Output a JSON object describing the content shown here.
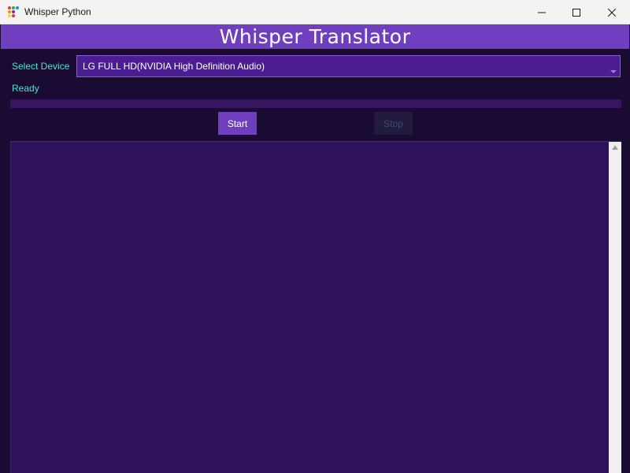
{
  "window": {
    "title": "Whisper Python",
    "controls": {
      "minimize_icon": "minimize-icon",
      "maximize_icon": "maximize-icon",
      "close_icon": "close-icon"
    }
  },
  "header": {
    "title": "Whisper Translator"
  },
  "device": {
    "label": "Select Device",
    "selected": "LG FULL HD(NVIDIA High Definition Audio)"
  },
  "status": {
    "text": "Ready"
  },
  "progress": {
    "value": 0
  },
  "buttons": {
    "start_label": "Start",
    "stop_label": "Stop"
  },
  "output": {
    "text": ""
  },
  "colors": {
    "background": "#1a0b33",
    "accent": "#6f3fc0",
    "label_text": "#4ee0d0",
    "select_bg": "#4a1d91",
    "output_bg": "#2e1259"
  }
}
